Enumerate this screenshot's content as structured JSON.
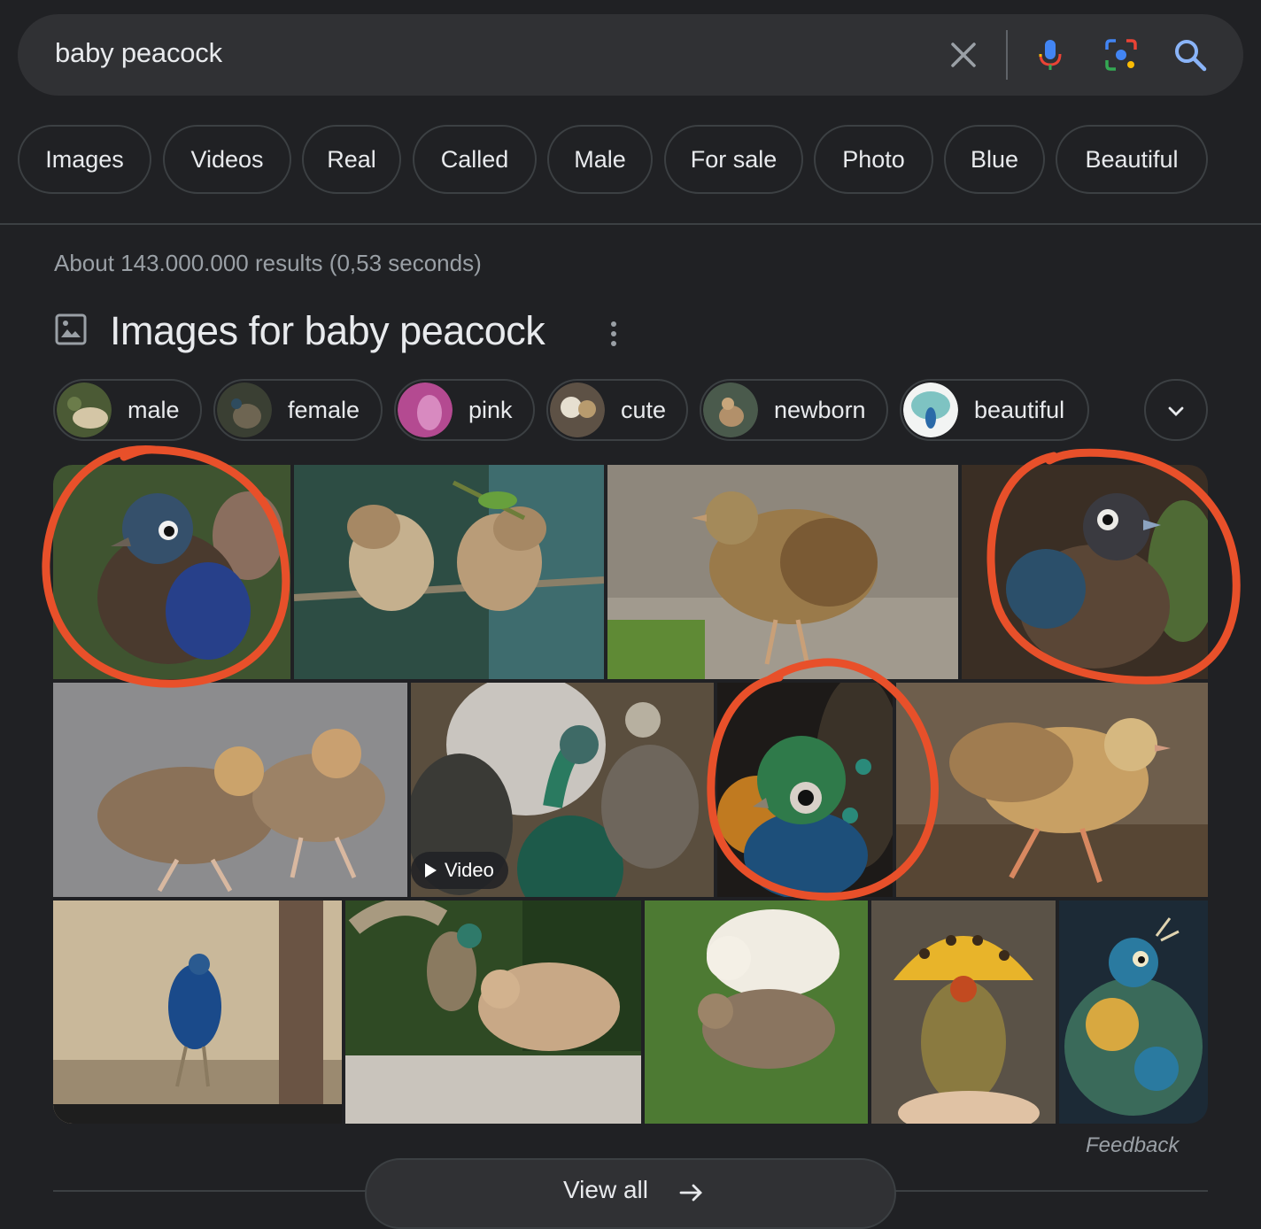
{
  "search": {
    "query": "baby peacock"
  },
  "icons": {
    "clear": "close-icon",
    "voice": "microphone-icon",
    "lens": "camera-lens-icon",
    "search": "search-icon",
    "images_header": "image-icon",
    "more": "more-vert-icon",
    "expand": "chevron-down-icon",
    "view_all": "arrow-right-icon",
    "video": "play-icon"
  },
  "chips": [
    {
      "label": "Images"
    },
    {
      "label": "Videos"
    },
    {
      "label": "Real"
    },
    {
      "label": "Called"
    },
    {
      "label": "Male"
    },
    {
      "label": "For sale"
    },
    {
      "label": "Photo"
    },
    {
      "label": "Blue"
    },
    {
      "label": "Beautiful"
    }
  ],
  "result_stats": "About 143.000.000 results (0,53 seconds)",
  "images_section": {
    "title": "Images for baby peacock",
    "filters": [
      {
        "label": "male"
      },
      {
        "label": "female"
      },
      {
        "label": "pink"
      },
      {
        "label": "cute"
      },
      {
        "label": "newborn"
      },
      {
        "label": "beautiful"
      }
    ],
    "video_badge": "Video",
    "feedback": "Feedback",
    "view_all": "View all"
  },
  "colors": {
    "background": "#202124",
    "surface": "#303134",
    "border": "#3c4043",
    "text": "#e8eaed",
    "muted": "#9aa0a6",
    "annotation": "#e8502a"
  }
}
